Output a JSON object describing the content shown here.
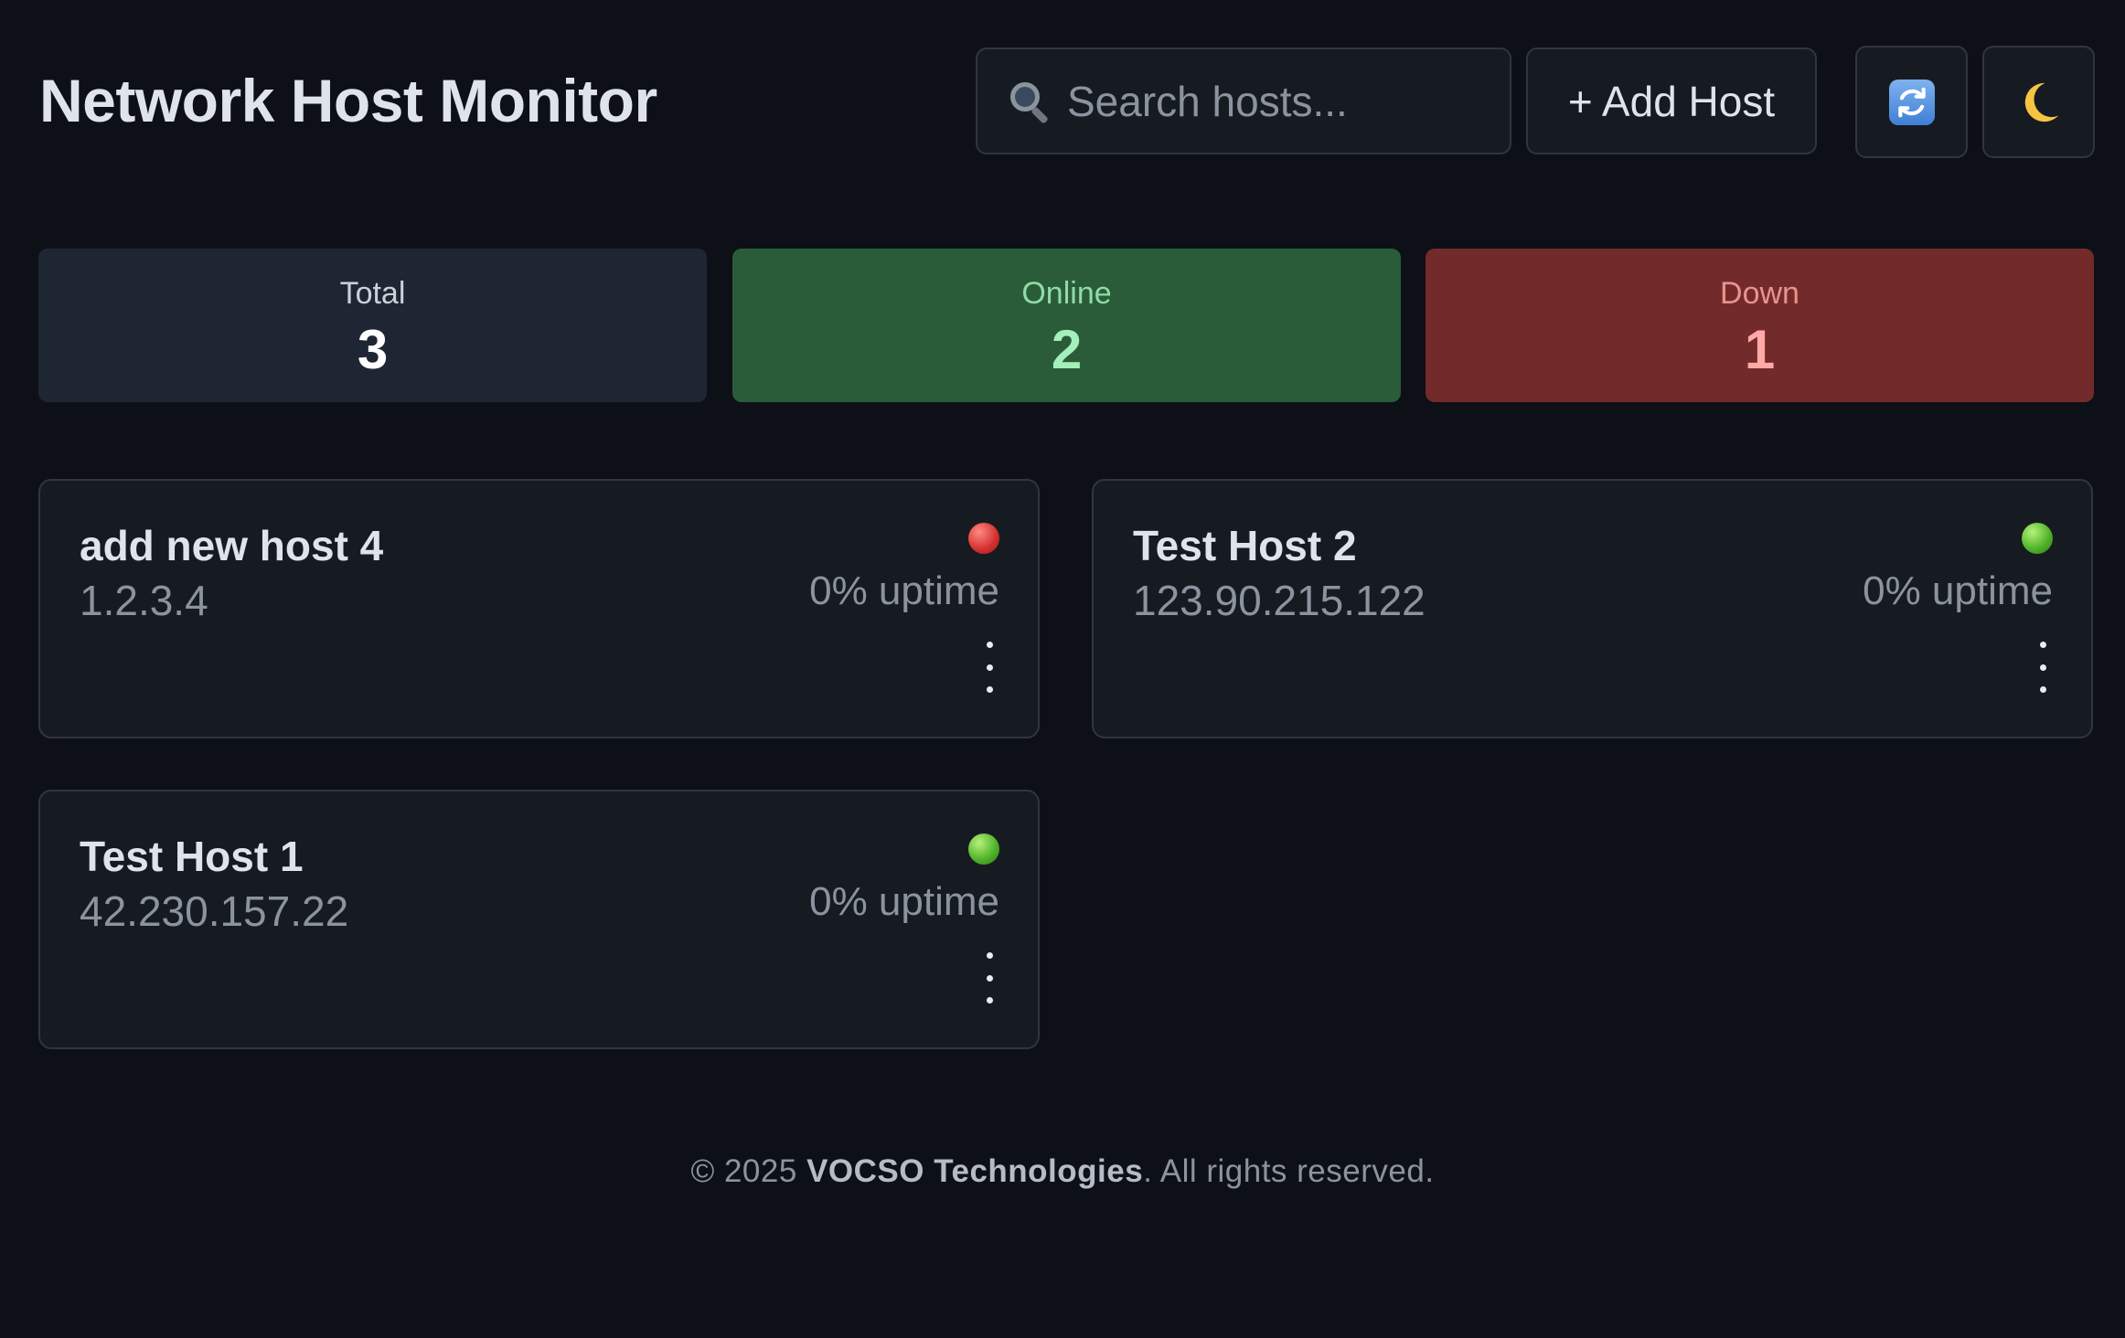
{
  "header": {
    "title": "Network Host Monitor",
    "search_placeholder": "Search hosts...",
    "add_host_label": "+ Add Host",
    "refresh_icon": "refresh-icon",
    "theme_icon": "moon-icon"
  },
  "stats": {
    "total": {
      "label": "Total",
      "value": "3"
    },
    "online": {
      "label": "Online",
      "value": "2"
    },
    "down": {
      "label": "Down",
      "value": "1"
    }
  },
  "hosts": [
    {
      "name": "add new host 4",
      "ip": "1.2.3.4",
      "uptime": "0% uptime",
      "status": "down"
    },
    {
      "name": "Test Host 2",
      "ip": "123.90.215.122",
      "uptime": "0% uptime",
      "status": "online"
    },
    {
      "name": "Test Host 1",
      "ip": "42.230.157.22",
      "uptime": "0% uptime",
      "status": "online"
    }
  ],
  "footer": {
    "prefix": "© 2025 ",
    "company": "VOCSO Technologies",
    "suffix": ". All rights reserved."
  },
  "colors": {
    "background": "#0d1117",
    "online": "#4caf27",
    "down": "#d32f2f"
  }
}
